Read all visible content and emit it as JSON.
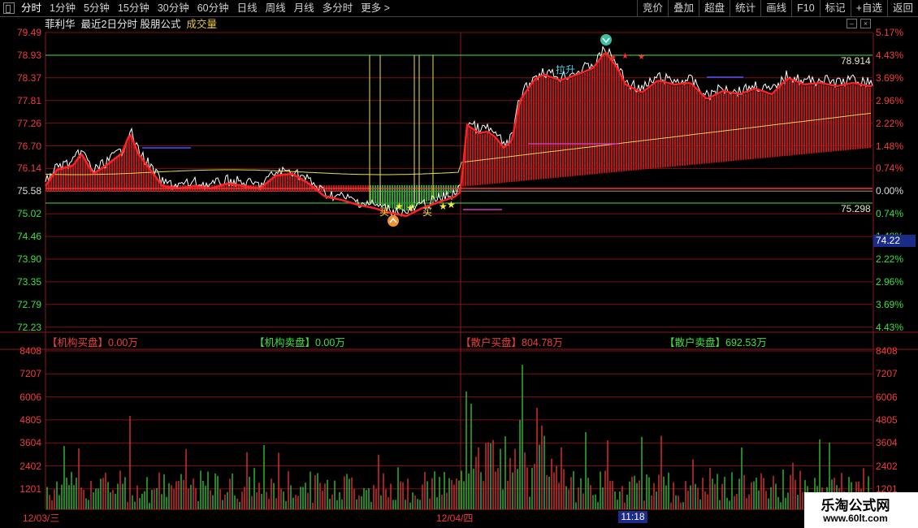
{
  "toolbar": {
    "left_items": [
      "分时",
      "1分钟",
      "5分钟",
      "15分钟",
      "30分钟",
      "60分钟",
      "日线",
      "周线",
      "月线",
      "多分时",
      "更多 >"
    ],
    "right_items": [
      "竞价",
      "叠加",
      "超盘",
      "统计",
      "画线",
      "F10",
      "标记",
      "+自选",
      "返回"
    ]
  },
  "info": {
    "stock_name": "菲利华",
    "subtitle": "最近2日分时 股朋公式",
    "volume_label": "成交量"
  },
  "price_axis": {
    "left": [
      "79.49",
      "78.93",
      "78.37",
      "77.81",
      "77.26",
      "76.70",
      "76.14",
      "75.58",
      "75.02",
      "74.46",
      "73.90",
      "73.35",
      "72.79",
      "72.23"
    ],
    "right": [
      "5.17%",
      "4.43%",
      "3.69%",
      "2.96%",
      "2.22%",
      "1.48%",
      "0.74%",
      "0.00%",
      "0.74%",
      "1.48%",
      "2.22%",
      "2.96%",
      "3.69%",
      "4.43%"
    ],
    "current_price": "74.22",
    "high_level": "78.914",
    "low_level": "75.298"
  },
  "volume_axis": {
    "labels": [
      "8408",
      "7207",
      "6006",
      "4805",
      "3604",
      "2402",
      "1201"
    ]
  },
  "flow_header": {
    "inst_buy": "【机构买盘】0.00万",
    "inst_sell": "【机构卖盘】0.00万",
    "retail_buy": "【散户买盘】804.78万",
    "retail_sell": "【散户卖盘】692.53万"
  },
  "annotations": {
    "up_label": "拉升",
    "buy_label": "买",
    "sell_marker": "⌄",
    "buy_marker": "^"
  },
  "dates": {
    "day1": "12/03/三",
    "day2": "12/04/四",
    "cursor_time": "11:18"
  },
  "watermark": {
    "title": "乐淘公式网",
    "url": "www.60lt.com"
  },
  "colors": {
    "up": "#f03c3c",
    "down": "#3ce03c",
    "grid": "#7a1010",
    "price_line": "#ffffff",
    "avg_line": "#e8e050"
  }
}
